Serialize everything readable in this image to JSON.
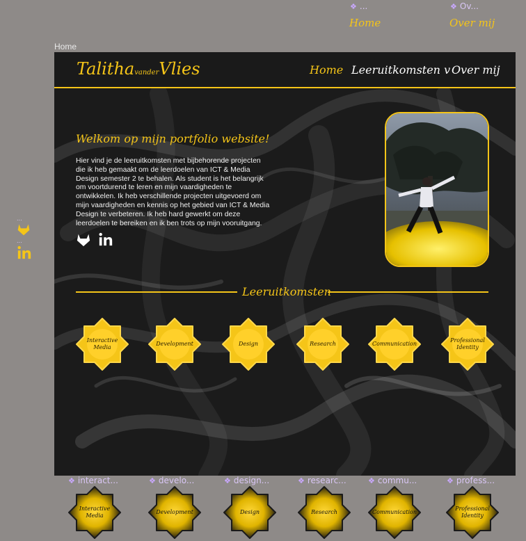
{
  "floating_top": {
    "home_tag": "...",
    "home_link": "Home",
    "about_tag": "Ov...",
    "about_link": "Over mij"
  },
  "frame_label": "Home",
  "logo": {
    "first": "Talitha",
    "middle": "vander",
    "last": "Vlies"
  },
  "nav": {
    "home": "Home",
    "outcomes": "Leeruitkomsten v",
    "about": "Over mij"
  },
  "welcome_title": "Welkom op mijn portfolio website!",
  "intro_text": "Hier vind je de leeruitkomsten met bijbehorende projecten die ik heb gemaakt om de leerdoelen van ICT & Media Design semester 2 te behalen. Als student is het belangrijk om voortdurend te leren en mijn vaardigheden te ontwikkelen. Ik heb verschillende projecten uitgevoerd om mijn vaardigheden en kennis op het gebied van ICT & Media Design te verbeteren. Ik heb hard gewerkt om deze leerdoelen te bereiken en ik ben trots op mijn vooruitgang.",
  "section_title": "Leeruitkomsten",
  "badges": [
    {
      "label": "Interactive Media",
      "tag": "interact..."
    },
    {
      "label": "Development",
      "tag": "develo..."
    },
    {
      "label": "Design",
      "tag": "design..."
    },
    {
      "label": "Research",
      "tag": "researc..."
    },
    {
      "label": "Communication",
      "tag": "commu..."
    },
    {
      "label": "Professional Identity",
      "tag": "profess..."
    }
  ],
  "floating_side": {
    "gitlab_tag": "...",
    "linkedin_tag": "..."
  },
  "colors": {
    "accent": "#f5c518",
    "background": "#1b1b1b",
    "canvas": "#8e8a88",
    "component_tag": "#c9a8ff"
  },
  "icons": {
    "social_1": "gitlab-icon",
    "social_2": "linkedin-icon",
    "component": "diamond-component-icon"
  }
}
